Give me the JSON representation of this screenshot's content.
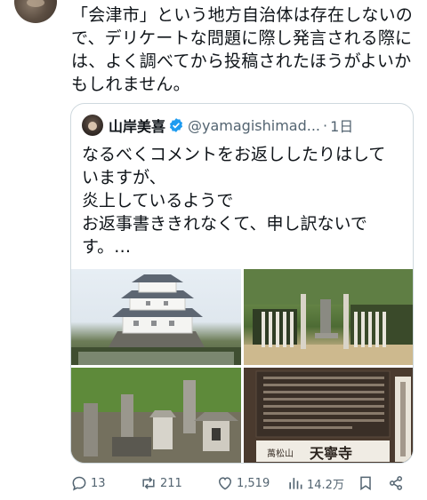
{
  "post": {
    "text": "「会津市」という地方自治体は存在しないので、デリケートな問題に際し発言される際には、よく調べてから投稿されたほうがよいかもしれません。"
  },
  "quoted_post": {
    "author_name": "山岸美喜",
    "handle": "@yamagishimad...",
    "separator": "·",
    "time": "1日",
    "text_lines": [
      "なるべくコメントをお返ししたりはして",
      "いますが、",
      "炎上しているようで",
      "お返事書ききれなくて、申し訳ないで",
      "す。…"
    ],
    "images": [
      "castle-photo",
      "monument-photo",
      "graves-photo",
      "signboard-photo"
    ],
    "signboard": {
      "mountain": "萬松山",
      "temple": "天寧寺"
    }
  },
  "actions": {
    "replies": "13",
    "reposts": "211",
    "likes": "1,519",
    "views": "14.2万"
  },
  "icons": [
    "reply-icon",
    "repost-icon",
    "like-icon",
    "views-icon",
    "bookmark-icon",
    "share-icon",
    "verified-icon"
  ],
  "colors": {
    "text": "#0f1419",
    "secondary": "#536471",
    "border": "#cfd9de",
    "verified": "#1d9bf0"
  }
}
